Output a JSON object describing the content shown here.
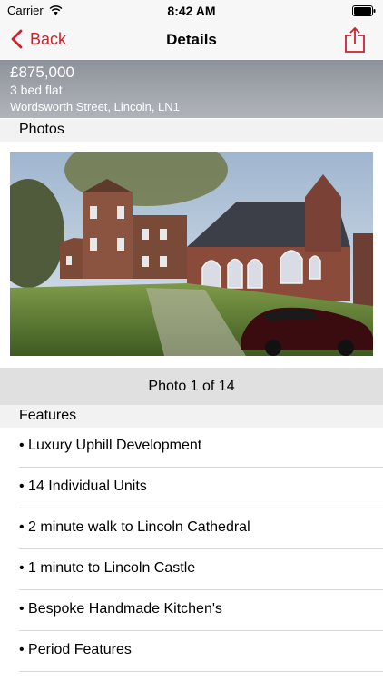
{
  "status_bar": {
    "carrier": "Carrier",
    "time": "8:42 AM"
  },
  "nav": {
    "back_label": "Back",
    "title": "Details",
    "accent_color": "#d0202e"
  },
  "listing": {
    "price": "£875,000",
    "type": "3 bed flat",
    "address": "Wordsworth Street, Lincoln, LN1"
  },
  "photos": {
    "header": "Photos",
    "counter": "Photo 1 of 14"
  },
  "features": {
    "header": "Features",
    "items": [
      "• Luxury Uphill Development",
      "• 14 Individual Units",
      "• 2 minute walk to Lincoln Cathedral",
      "• 1 minute to Lincoln Castle",
      "• Bespoke Handmade Kitchen's",
      "• Period Features"
    ]
  },
  "icons": {
    "wifi": "wifi-icon",
    "battery": "battery-icon",
    "back": "chevron-left-icon",
    "share": "share-icon"
  }
}
